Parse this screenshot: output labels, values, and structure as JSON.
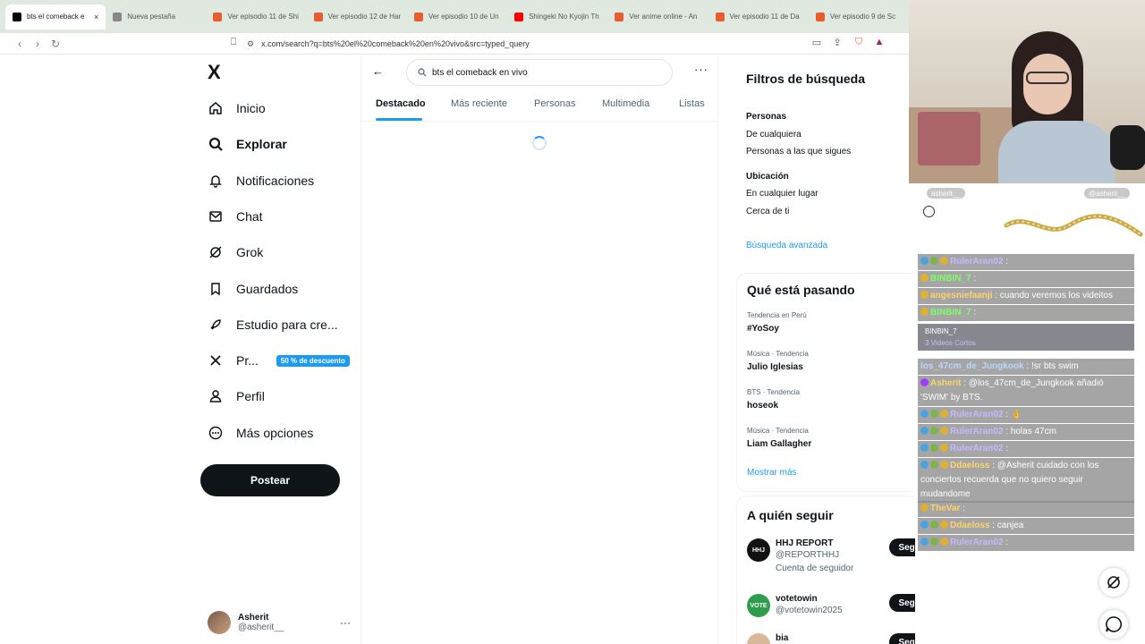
{
  "browser": {
    "tabs": [
      {
        "label": "bts el comeback e",
        "active": true,
        "color": "#000000"
      },
      {
        "label": "Nueva pestaña",
        "active": false,
        "color": "#888888"
      },
      {
        "label": "Ver episodio 11 de Shi",
        "active": false,
        "color": "#e85c30"
      },
      {
        "label": "Ver episodio 12 de Har",
        "active": false,
        "color": "#e85c30"
      },
      {
        "label": "Ver episodio 10 de Un",
        "active": false,
        "color": "#e85c30"
      },
      {
        "label": "Shingeki No Kyojin Th",
        "active": false,
        "color": "#ff0000"
      },
      {
        "label": "Ver anime online - An",
        "active": false,
        "color": "#e85c30"
      },
      {
        "label": "Ver episodio 11 de Da",
        "active": false,
        "color": "#e85c30"
      },
      {
        "label": "Ver episodio 9 de Sc",
        "active": false,
        "color": "#e85c30"
      }
    ],
    "close_glyph": "×",
    "url": "x.com/search?q=bts%20el%20comeback%20en%20vivo&src=typed_query"
  },
  "sidebar": {
    "logo": "X",
    "items": [
      {
        "label": "Inicio",
        "icon": "home-icon",
        "bold": false
      },
      {
        "label": "Explorar",
        "icon": "search-icon",
        "bold": true
      },
      {
        "label": "Notificaciones",
        "icon": "bell-icon",
        "bold": false
      },
      {
        "label": "Chat",
        "icon": "mail-icon",
        "bold": false
      },
      {
        "label": "Grok",
        "icon": "grok-icon",
        "bold": false
      },
      {
        "label": "Guardados",
        "icon": "bookmark-icon",
        "bold": false
      },
      {
        "label": "Estudio para cre...",
        "icon": "rocket-icon",
        "bold": false
      },
      {
        "label": "Pr...",
        "icon": "x-premium-icon",
        "bold": false,
        "badge": "50 % de descuento"
      },
      {
        "label": "Perfil",
        "icon": "person-icon",
        "bold": false
      },
      {
        "label": "Más opciones",
        "icon": "more-circle-icon",
        "bold": false
      }
    ],
    "post_button": "Postear",
    "user": {
      "name": "Asherit",
      "handle": "@asherit__",
      "menu": "···"
    }
  },
  "main": {
    "search_value": "bts el comeback en vivo",
    "more": "···",
    "tabs": [
      "Destacado",
      "Más reciente",
      "Personas",
      "Multimedia",
      "Listas"
    ],
    "active_tab": 0
  },
  "right": {
    "filters": {
      "title": "Filtros de búsqueda",
      "people_label": "Personas",
      "people_opts": [
        "De cualquiera",
        "Personas a las que sigues"
      ],
      "location_label": "Ubicación",
      "location_opts": [
        "En cualquier lugar",
        "Cerca de ti"
      ],
      "advanced": "Búsqueda avanzada"
    },
    "trends": {
      "title": "Qué está pasando",
      "items": [
        {
          "meta": "Tendencia en Perú",
          "name": "#YoSoy"
        },
        {
          "meta": "Música · Tendencia",
          "name": "Julio Iglesias"
        },
        {
          "meta": "BTS · Tendencia",
          "name": "hosеok"
        },
        {
          "meta": "Música · Tendencia",
          "name": "Liam Gallagher"
        }
      ],
      "show_more": "Mostrar más"
    },
    "follow": {
      "title": "A quién seguir",
      "items": [
        {
          "name": "HHJ REPORT",
          "handle": "@REPORTHHJ",
          "extra": "Cuenta de seguidor",
          "avatar_text": "HHJ",
          "avatar_color": "#111111",
          "button": "Seguir"
        },
        {
          "name": "votetowin",
          "handle": "@votetowin2025",
          "extra": "",
          "avatar_text": "VOTE",
          "avatar_color": "#2e9d4b",
          "button": "Seguir"
        },
        {
          "name": "bia",
          "handle": "",
          "extra": "",
          "avatar_text": "",
          "avatar_color": "#d8b89a",
          "button": "Seguir"
        }
      ]
    }
  },
  "overlay": {
    "chat_chips": [
      "asherit__",
      "@asherit__"
    ],
    "messages": [
      {
        "user": "RulerAran02",
        "text": " : ",
        "badges": [
          "#4aa3e0",
          "#7fb24a",
          "#e0b030"
        ],
        "user_color": "#c7b8ff"
      },
      {
        "user": "BINBIN_7",
        "text": " : ",
        "badges": [
          "#e0b030"
        ],
        "user_color": "#7dff6a"
      },
      {
        "user": "angesniefaanji",
        "text": " : cuando veremos los videitos",
        "badges": [
          "#e0b030"
        ],
        "user_color": "#ffd36a"
      },
      {
        "user": "BINBIN_7",
        "text": " : ",
        "badges": [
          "#e0b030"
        ],
        "user_color": "#7dff6a"
      },
      {
        "user": "los_47cm_de_Jungkook",
        "text": " : !sr bts swim",
        "badges": [],
        "user_color": "#bcd7ff"
      },
      {
        "user": "Asherit",
        "text": " : @los_47cm_de_Jungkook añadió 'SWIM' by BTS.",
        "badges": [
          "#a03cff"
        ],
        "user_color": "#ffd36a"
      },
      {
        "user": "RulerAran02",
        "text": " : 👌",
        "badges": [
          "#4aa3e0",
          "#7fb24a",
          "#e0b030"
        ],
        "user_color": "#c7b8ff"
      },
      {
        "user": "RulerAran02",
        "text": " : holas 47cm",
        "badges": [
          "#4aa3e0",
          "#7fb24a",
          "#e0b030"
        ],
        "user_color": "#c7b8ff"
      },
      {
        "user": "RulerAran02",
        "text": " : ",
        "badges": [
          "#4aa3e0",
          "#7fb24a",
          "#e0b030"
        ],
        "user_color": "#c7b8ff"
      },
      {
        "user": "Ddaeloss",
        "text": " : @Asherit cuidado con los conciertos recuerda que no quiero seguir mudandome",
        "badges": [
          "#4aa3e0",
          "#7fb24a",
          "#e0b030"
        ],
        "user_color": "#ffd36a"
      },
      {
        "user": "TheVar",
        "text": " : ",
        "badges": [
          "#e0b030"
        ],
        "user_color": "#ffd36a"
      },
      {
        "user": "Ddaeloss",
        "text": " : canjea",
        "badges": [
          "#4aa3e0",
          "#7fb24a",
          "#e0b030"
        ],
        "user_color": "#ffd36a"
      },
      {
        "user": "RulerAran02",
        "text": " : ",
        "badges": [
          "#4aa3e0",
          "#7fb24a",
          "#e0b030"
        ],
        "user_color": "#c7b8ff"
      }
    ],
    "highlight": {
      "user": "BINBIN_7",
      "sub": "3 Videos Cortos"
    }
  }
}
